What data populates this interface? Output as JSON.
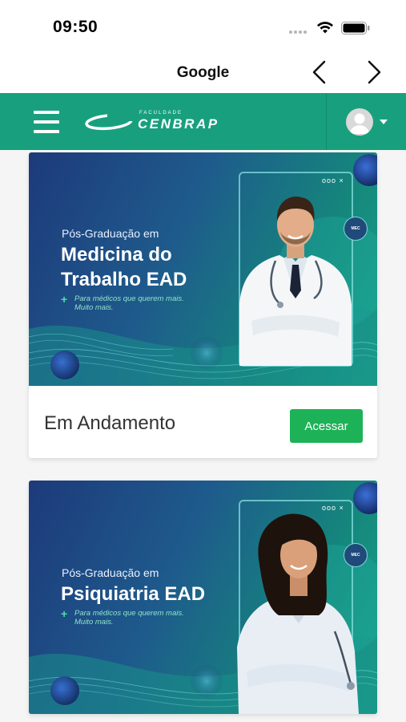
{
  "status_bar": {
    "time": "09:50"
  },
  "browser": {
    "title": "Google"
  },
  "header": {
    "logo_small": "FACULDADE",
    "logo_main": "CENBRAP"
  },
  "cards": [
    {
      "subtitle": "Pós-Graduação em",
      "title_line1": "Medicina do",
      "title_line2": "Trabalho EAD",
      "tagline_line1": "Para médicos que querem mais.",
      "tagline_line2": "Muito mais.",
      "badge": "MEC",
      "frame_dots": "ooo ×",
      "status": "Em Andamento",
      "button": "Acessar"
    },
    {
      "subtitle": "Pós-Graduação em",
      "title_line1": "Psiquiatria EAD",
      "tagline_line1": "Para médicos que querem mais.",
      "tagline_line2": "Muito mais.",
      "badge": "MEC",
      "frame_dots": "ooo ×"
    }
  ],
  "colors": {
    "header": "#18a07e",
    "button": "#1db257"
  }
}
